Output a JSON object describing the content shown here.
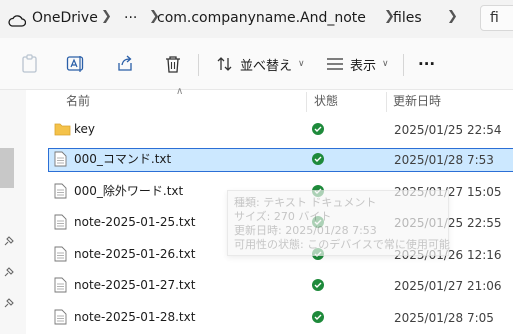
{
  "breadcrumb": {
    "root": "OneDrive",
    "overflow": "···",
    "folder": "com.companyname.And_note",
    "current": "files",
    "search_stub": "fi"
  },
  "toolbar": {
    "sort_label": "並べ替え",
    "view_label": "表示",
    "more_label": "···"
  },
  "columns": {
    "name": "名前",
    "status": "状態",
    "modified": "更新日時"
  },
  "files": [
    {
      "name": "key",
      "type": "folder",
      "date": "2025/01/25 22:54"
    },
    {
      "name": "000_コマンド.txt",
      "type": "text",
      "date": "2025/01/28 7:53",
      "selected": true
    },
    {
      "name": "000_除外ワード.txt",
      "type": "text",
      "date": "2025/01/27 15:05"
    },
    {
      "name": "note-2025-01-25.txt",
      "type": "text",
      "date": "2025/01/25 22:55"
    },
    {
      "name": "note-2025-01-26.txt",
      "type": "text",
      "date": "2025/01/26 12:16"
    },
    {
      "name": "note-2025-01-27.txt",
      "type": "text",
      "date": "2025/01/27 21:06"
    },
    {
      "name": "note-2025-01-28.txt",
      "type": "text",
      "date": "2025/01/28 7:05"
    }
  ],
  "tooltip": {
    "type": "種類: テキスト ドキュメント",
    "size": "サイズ: 270 バイト",
    "modified": "更新日時: 2025/01/28 7:53",
    "availability": "可用性の状態: このデバイスで常に使用可能"
  },
  "colors": {
    "selection_bg": "#cce8ff",
    "selection_border": "#2b6fd6",
    "status_green": "#1e8a3b",
    "folder_yellow": "#f4c24a"
  }
}
